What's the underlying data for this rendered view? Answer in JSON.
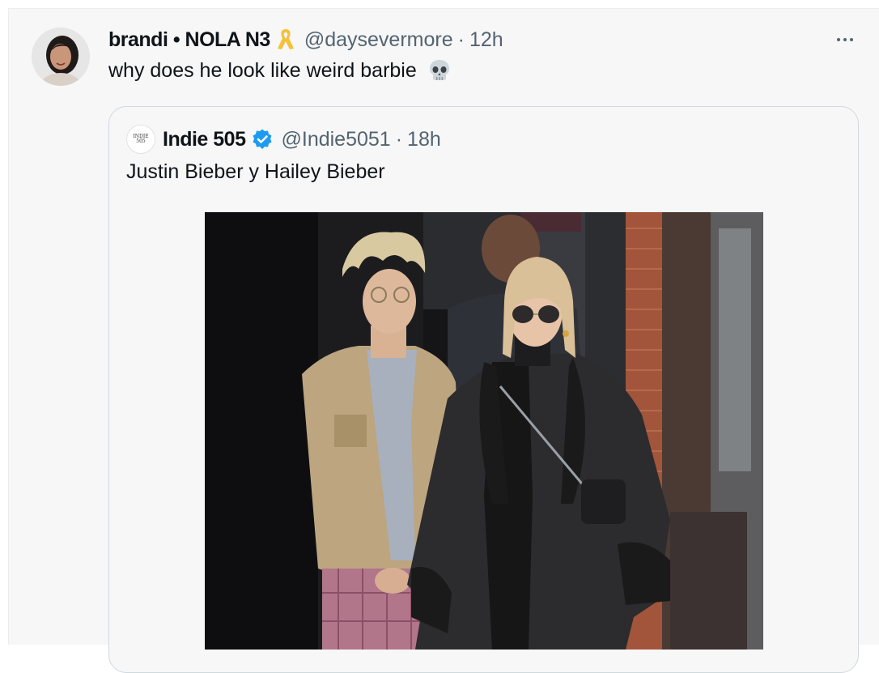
{
  "tweet": {
    "display_name": "brandi • NOLA N3",
    "handle": "@daysevermore",
    "separator": "·",
    "time": "12h",
    "text": "why does he look like weird barbie",
    "badge_icon": "ribbon-icon",
    "text_emoji_icon": "skull-icon",
    "menu_icon": "more-icon"
  },
  "quote": {
    "display_name": "Indie 505",
    "handle": "@Indie5051",
    "separator": "·",
    "time": "18h",
    "text": "Justin Bieber y Hailey Bieber",
    "avatar_text_top": "INDIE",
    "avatar_text_bottom": "505",
    "verified_icon": "verified-icon",
    "verified_color": "#1d9bf0"
  },
  "colors": {
    "text_primary": "#0f1419",
    "text_secondary": "#536471",
    "border": "#cfd9de",
    "ribbon": "#f5c13b"
  }
}
